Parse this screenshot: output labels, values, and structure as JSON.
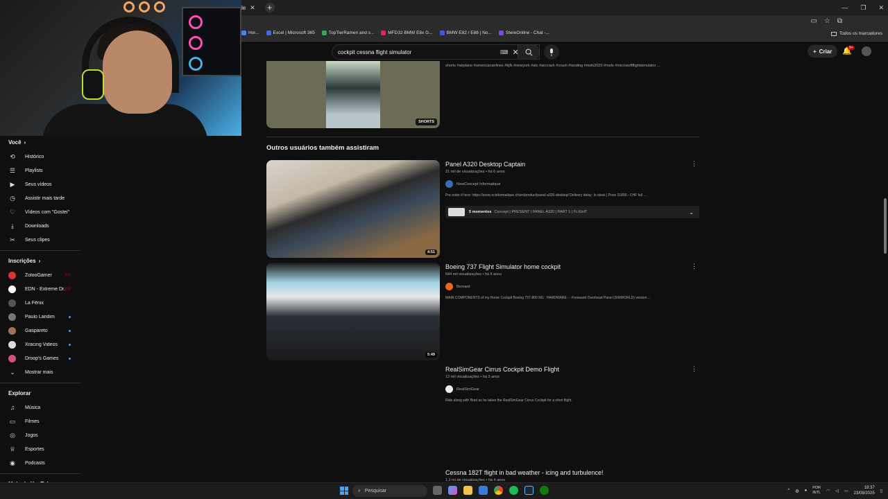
{
  "browser": {
    "tab_title": "le",
    "bookmarks": [
      {
        "label": "Hor...",
        "color": "#4285f4"
      },
      {
        "label": "Excel | Microsoft 365",
        "color": "#3b6bd6"
      },
      {
        "label": "TopTierRamen and s...",
        "color": "#3aa655"
      },
      {
        "label": "MFD32 BMW E8x G...",
        "color": "#e0245e"
      },
      {
        "label": "BMW E82 / E88 | No...",
        "color": "#3b5bdb"
      },
      {
        "label": "StereOnline - Chat -...",
        "color": "#7c4ddc"
      }
    ],
    "all_bookmarks": "Todos os marcadores"
  },
  "header": {
    "search_value": "cockpit cessna flight simulator",
    "create_label": "Criar",
    "notification_badge": "9+"
  },
  "sidebar": {
    "you_title": "Você",
    "you_items": [
      {
        "label": "Histórico",
        "icon": "history-icon",
        "glyph": "⟲"
      },
      {
        "label": "Playlists",
        "icon": "playlist-icon",
        "glyph": "☰"
      },
      {
        "label": "Seus vídeos",
        "icon": "video-icon",
        "glyph": "▶"
      },
      {
        "label": "Assistir mais tarde",
        "icon": "clock-icon",
        "glyph": "◷"
      },
      {
        "label": "Vídeos com \"Gostei\"",
        "icon": "thumbs-up-icon",
        "glyph": "👍"
      },
      {
        "label": "Downloads",
        "icon": "download-icon",
        "glyph": "⤓"
      },
      {
        "label": "Seus clipes",
        "icon": "scissors-icon",
        "glyph": "✂"
      }
    ],
    "subs_title": "Inscrições",
    "subs": [
      {
        "label": "ZolooGamer",
        "color": "#d9342b",
        "status": "live"
      },
      {
        "label": "EDN - Extreme Dr...",
        "color": "#ffffff",
        "status": "live"
      },
      {
        "label": "La Fênix",
        "color": "#555555",
        "status": "none"
      },
      {
        "label": "Paulo Landim",
        "color": "#777777",
        "status": "dot"
      },
      {
        "label": "Gaspareto",
        "color": "#a0705a",
        "status": "dot"
      },
      {
        "label": "Xracing Videos",
        "color": "#dddddd",
        "status": "dot"
      },
      {
        "label": "Droop's Games",
        "color": "#d4507a",
        "status": "dot"
      }
    ],
    "show_more": "Mostrar mais",
    "explore_title": "Explorar",
    "explore_items": [
      {
        "label": "Música",
        "icon": "music-icon",
        "glyph": "♫"
      },
      {
        "label": "Filmes",
        "icon": "film-icon",
        "glyph": "▭"
      },
      {
        "label": "Jogos",
        "icon": "gamepad-icon",
        "glyph": "◎"
      },
      {
        "label": "Esportes",
        "icon": "trophy-icon",
        "glyph": "♕"
      },
      {
        "label": "Podcasts",
        "icon": "podcast-icon",
        "glyph": "◉"
      }
    ],
    "more_title": "Mais do YouTube"
  },
  "results": {
    "short_desc": "shorts #airplane #americanairlines #kjfk #newyork #atc #aircrash #crash #landing #msfs2020 #msfs #microsoftflightsimulator ...",
    "shorts_label": "SHORTS",
    "shelf_title": "Outros usuários também assistiram",
    "videos": [
      {
        "title": "Panel A320 Desktop Captain",
        "meta": "21 mil de visualizações • há 6 anos",
        "channel": "NewConcept Informatique",
        "channel_color": "#3b6bb5",
        "desc": "Pre order it here: https://store.ncinformatique.ch/en/product/panel-a320-desktop/ Delivery delay: In stock | Price 31890.- CHF full ...",
        "duration": "4:51",
        "chapters_count": "5 momentos",
        "chapters_text": "Concept | PRESENT | PANEL A320 | PART 1 | FLIGHT"
      },
      {
        "title": "Boeing 737 Flight Simulator home cockpit",
        "meta": "644 mil visualizações • há 5 anos",
        "channel": "Bernard",
        "channel_color": "#e8671a",
        "desc": "MAIN COMPONENTS of my Home Cockpit Boeing 737-800 NG : HARDWARE : - Foreward Overhead Panel (SIMWORLD) version ...",
        "duration": "5:49"
      },
      {
        "title": "RealSimGear Cirrus Cockpit Demo Flight",
        "meta": "13 mil visualizações • há 3 anos",
        "channel": "RealSimGear",
        "channel_color": "#eeeeee",
        "desc": "Ride along with Brad as he takes the RealSimGear Cirrus Cockpit for a short flight."
      },
      {
        "title": "Cessna 182T flight in bad weather - icing and turbulence!",
        "meta": "1,2 mi de visualizações • há 4 anos"
      }
    ]
  },
  "taskbar": {
    "search_label": "Pesquisar",
    "lang_top": "POR",
    "lang_bottom": "INTL",
    "time": "18:37",
    "date": "23/08/2025"
  }
}
